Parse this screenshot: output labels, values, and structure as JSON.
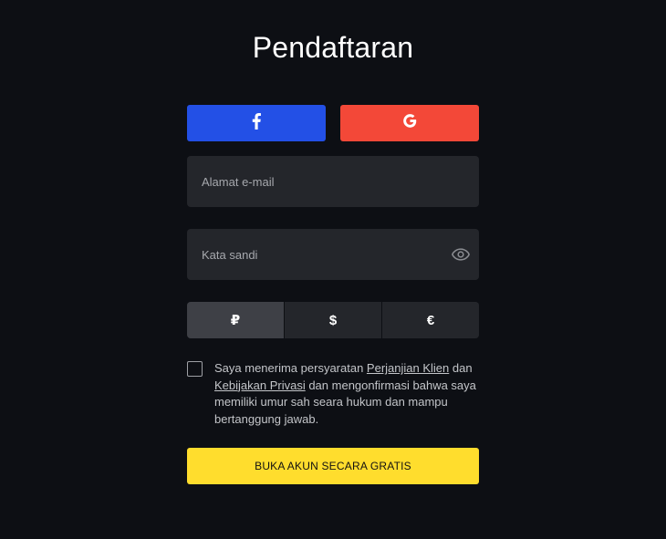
{
  "form": {
    "title": "Pendaftaran",
    "email_placeholder": "Alamat e-mail",
    "password_placeholder": "Kata sandi",
    "submit_label": "BUKA AKUN SECARA GRATIS"
  },
  "social": {
    "facebook": {
      "icon": "facebook-icon",
      "color": "#2350e6"
    },
    "google": {
      "icon": "google-icon",
      "color": "#f34838"
    }
  },
  "currency": {
    "options": [
      {
        "symbol": "₽",
        "active": true
      },
      {
        "symbol": "$",
        "active": false
      },
      {
        "symbol": "€",
        "active": false
      }
    ]
  },
  "terms": {
    "checked": false,
    "text_1": "Saya menerima persyaratan ",
    "link_agreement": "Perjanjian Klien",
    "text_2": " dan ",
    "link_privacy": "Kebijakan Privasi",
    "text_3": " dan mengonfirmasi bahwa saya memiliki umur sah seara hukum dan mampu bertanggung jawab."
  },
  "colors": {
    "background": "#0d0f14",
    "field": "#24262b",
    "accent": "#ffdd2d"
  }
}
